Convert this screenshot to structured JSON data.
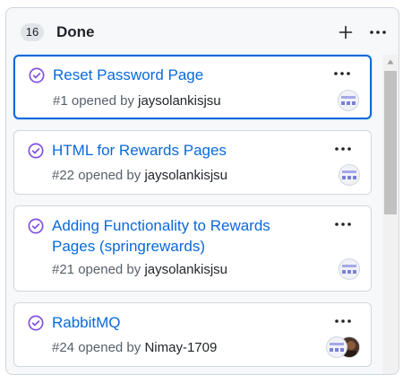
{
  "column": {
    "count": "16",
    "title": "Done"
  },
  "icons": {
    "add": "plus-icon",
    "menu": "kebab-horizontal-icon",
    "status": "check-circle-icon",
    "scroll_up": "triangle-up-icon"
  },
  "colors": {
    "link": "#0969da",
    "done_purple": "#8250df",
    "selected_border": "#0969da"
  },
  "cards": [
    {
      "title": "Reset Password Page",
      "number": "#1",
      "opened_text": "opened by",
      "user": "jaysolankisjsu"
    },
    {
      "title": "HTML for Rewards Pages",
      "number": "#22",
      "opened_text": "opened by",
      "user": "jaysolankisjsu"
    },
    {
      "title": "Adding Functionality to Rewards Pages (springrewards)",
      "number": "#21",
      "opened_text": "opened by",
      "user": "jaysolankisjsu"
    },
    {
      "title": "RabbitMQ",
      "number": "#24",
      "opened_text": "opened by",
      "user": "Nimay-1709"
    }
  ]
}
